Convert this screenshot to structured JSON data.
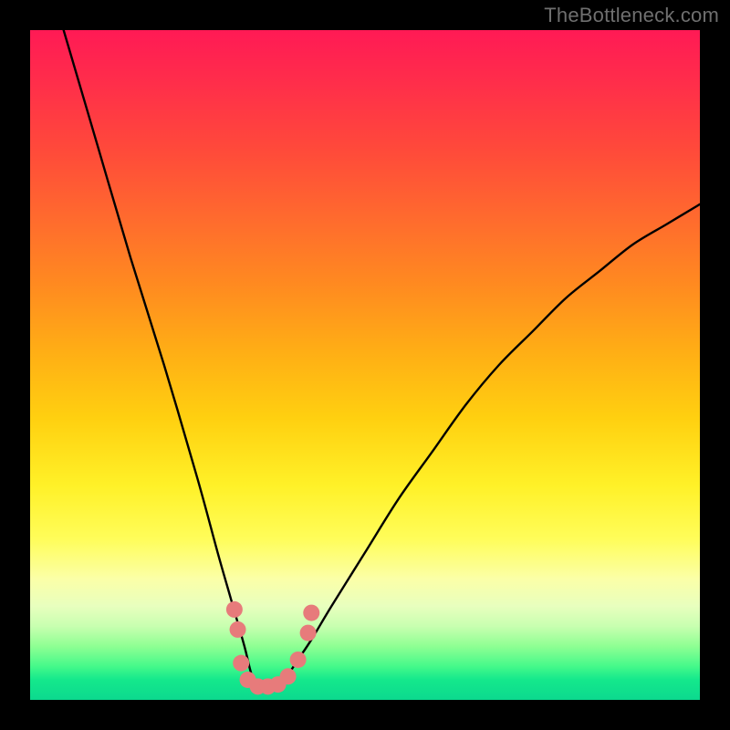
{
  "watermark": "TheBottleneck.com",
  "chart_data": {
    "type": "line",
    "title": "",
    "xlabel": "",
    "ylabel": "",
    "xlim": [
      0,
      100
    ],
    "ylim": [
      0,
      100
    ],
    "series": [
      {
        "name": "bottleneck-curve",
        "x": [
          5,
          10,
          15,
          20,
          25,
          28,
          30,
          32,
          33,
          34,
          35,
          36,
          37,
          38,
          40,
          42,
          45,
          50,
          55,
          60,
          65,
          70,
          75,
          80,
          85,
          90,
          95,
          100
        ],
        "values": [
          100,
          83,
          66,
          50,
          33,
          22,
          15,
          8,
          4,
          2,
          1.5,
          1.5,
          2,
          3,
          6,
          9,
          14,
          22,
          30,
          37,
          44,
          50,
          55,
          60,
          64,
          68,
          71,
          74
        ]
      }
    ],
    "markers": {
      "name": "curve-dots",
      "color": "#e77b7b",
      "points": [
        {
          "x": 30.5,
          "y": 13.5
        },
        {
          "x": 31.0,
          "y": 10.5
        },
        {
          "x": 31.5,
          "y": 5.5
        },
        {
          "x": 32.5,
          "y": 3.0
        },
        {
          "x": 34.0,
          "y": 2.0
        },
        {
          "x": 35.5,
          "y": 2.0
        },
        {
          "x": 37.0,
          "y": 2.3
        },
        {
          "x": 38.5,
          "y": 3.5
        },
        {
          "x": 40.0,
          "y": 6.0
        },
        {
          "x": 41.5,
          "y": 10.0
        },
        {
          "x": 42.0,
          "y": 13.0
        }
      ]
    },
    "gradient_stops": [
      {
        "pos": 0,
        "color": "#ff1a55"
      },
      {
        "pos": 18,
        "color": "#ff4a3a"
      },
      {
        "pos": 38,
        "color": "#ff8a20"
      },
      {
        "pos": 58,
        "color": "#ffd010"
      },
      {
        "pos": 76,
        "color": "#fffd5a"
      },
      {
        "pos": 88,
        "color": "#d0ffb4"
      },
      {
        "pos": 100,
        "color": "#0cd98e"
      }
    ]
  }
}
